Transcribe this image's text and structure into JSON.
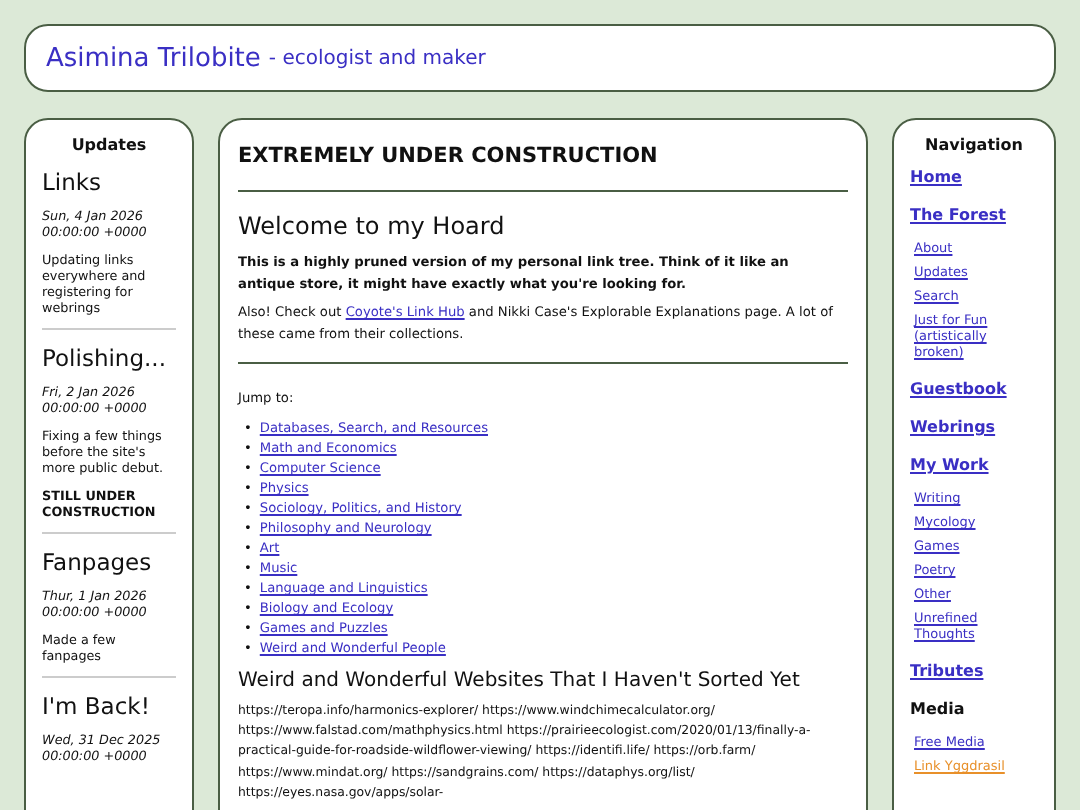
{
  "header": {
    "title": "Asimina Trilobite",
    "subtitle": "- ecologist and maker"
  },
  "updates": {
    "heading": "Updates",
    "entries": [
      {
        "title": "Links",
        "date": "Sun, 4 Jan 2026 00:00:00 +0000",
        "body": "Updating links everywhere and registering for webrings"
      },
      {
        "title": "Polishing...",
        "date": "Fri, 2 Jan 2026 00:00:00 +0000",
        "body": "Fixing a few things before the site's more public debut.",
        "note": "STILL UNDER CONSTRUCTION"
      },
      {
        "title": "Fanpages",
        "date": "Thur, 1 Jan 2026 00:00:00 +0000",
        "body": "Made a few fanpages"
      },
      {
        "title": "I'm Back!",
        "date": "Wed, 31 Dec 2025 00:00:00 +0000"
      }
    ]
  },
  "main": {
    "banner": "EXTREMELY UNDER CONSTRUCTION",
    "heading": "Welcome to my Hoard",
    "lead": "This is a highly pruned version of my personal link tree. Think of it like an antique store, it might have exactly what you're looking for.",
    "intro_before": "Also! Check out",
    "intro_link": "Coyote's Link Hub",
    "intro_after": "and Nikki Case's Explorable Explanations page. A lot of these came from their collections.",
    "jump_label": "Jump to:",
    "bullet": "•",
    "jump_links": [
      "Databases, Search, and Resources",
      "Math and Economics",
      "Computer Science",
      "Physics",
      "Sociology, Politics, and History",
      "Philosophy and Neurology",
      "Art",
      "Music",
      "Language and Linguistics",
      "Biology and Ecology",
      "Games and Puzzles",
      "Weird and Wonderful People"
    ],
    "section_heading": "Weird and Wonderful Websites That I Haven't Sorted Yet",
    "urls": "https://teropa.info/harmonics-explorer/ https://www.windchimecalculator.org/ https://www.falstad.com/mathphysics.html https://prairieecologist.com/2020/01/13/finally-a-practical-guide-for-roadside-wildflower-viewing/ https://identifi.life/ https://orb.farm/ https://www.mindat.org/ https://sandgrains.com/ https://dataphys.org/list/ https://eyes.nasa.gov/apps/solar-"
  },
  "navigation": {
    "heading": "Navigation",
    "items": [
      {
        "label": "Home",
        "kind": "link",
        "selected": false
      },
      {
        "label": "The Forest",
        "kind": "link",
        "selected": false,
        "children": [
          {
            "label": "About",
            "selected": false
          },
          {
            "label": "Updates",
            "selected": false
          },
          {
            "label": "Search",
            "selected": false
          },
          {
            "label": "Just for Fun (artistically broken)",
            "selected": false
          }
        ]
      },
      {
        "label": "Guestbook",
        "kind": "link",
        "selected": false
      },
      {
        "label": "Webrings",
        "kind": "link",
        "selected": false
      },
      {
        "label": "My Work",
        "kind": "link",
        "selected": false,
        "children": [
          {
            "label": "Writing",
            "selected": false
          },
          {
            "label": "Mycology",
            "selected": false
          },
          {
            "label": "Games",
            "selected": false
          },
          {
            "label": "Poetry",
            "selected": false
          },
          {
            "label": "Other",
            "selected": false
          },
          {
            "label": "Unrefined Thoughts",
            "selected": false
          }
        ]
      },
      {
        "label": "Tributes",
        "kind": "link",
        "selected": false
      },
      {
        "label": "Media",
        "kind": "heading",
        "selected": false,
        "children": [
          {
            "label": "Free Media",
            "selected": false
          },
          {
            "label": "Link Yggdrasil",
            "selected": true
          }
        ]
      }
    ]
  }
}
